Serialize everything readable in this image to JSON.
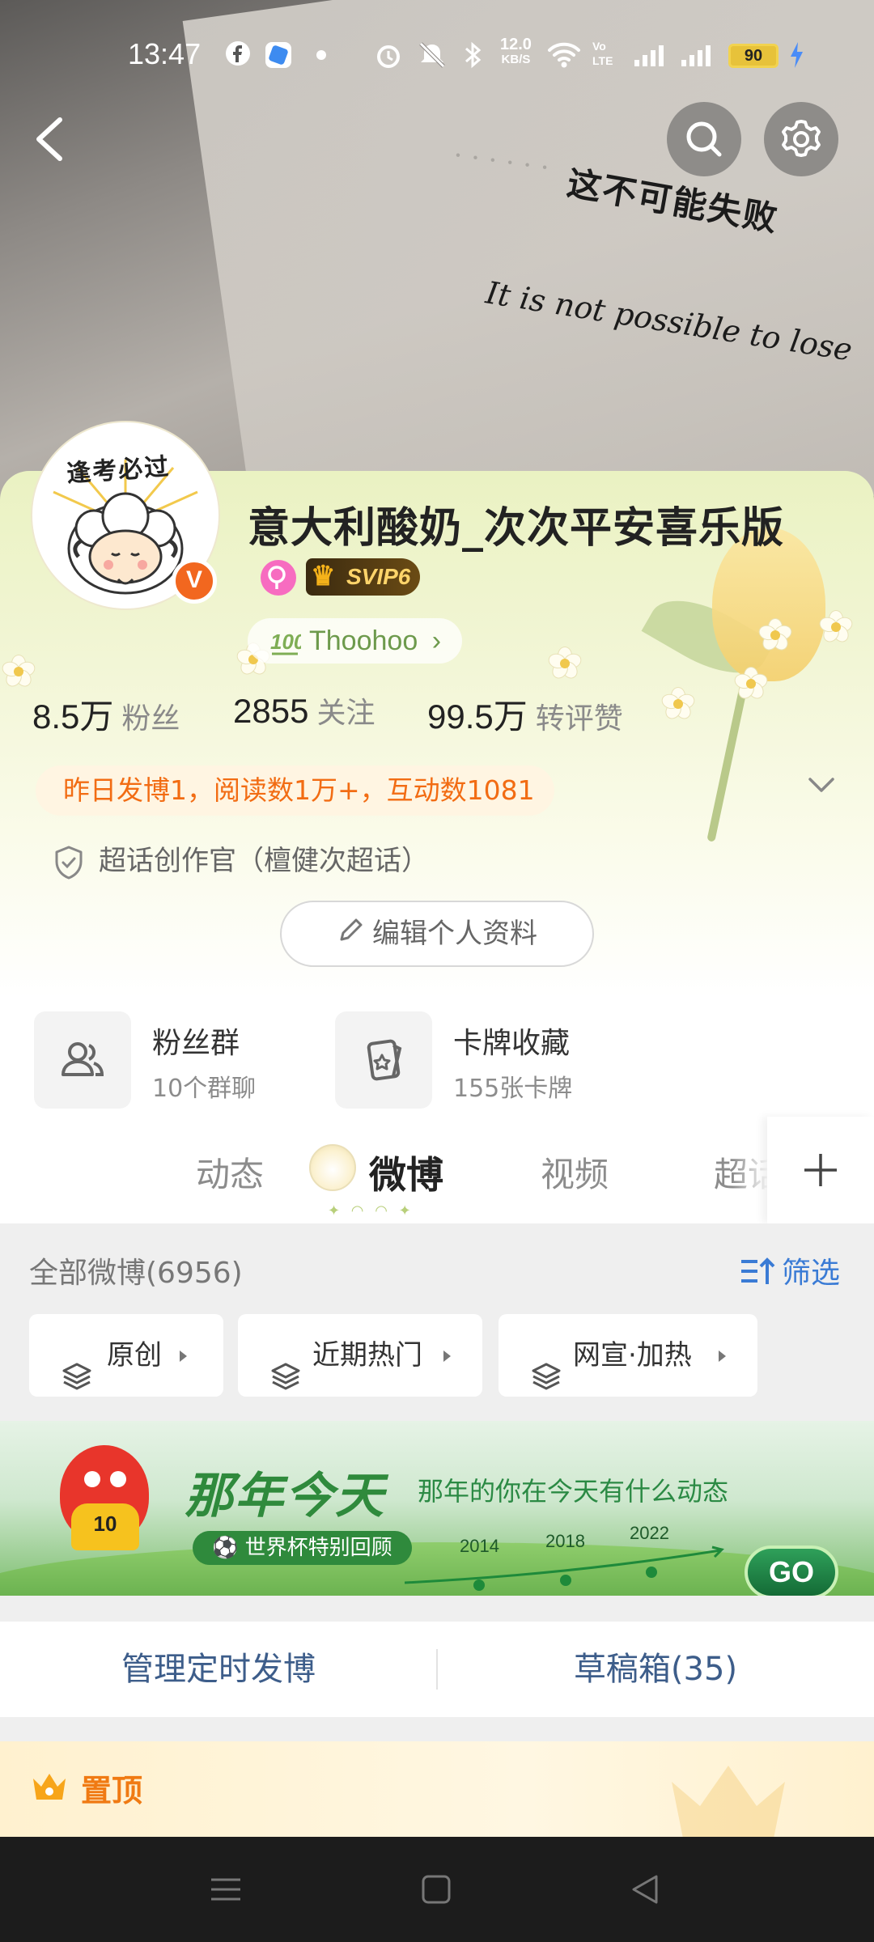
{
  "status_bar": {
    "time": "13:47",
    "net_speed": "12.0",
    "net_unit": "KB/S",
    "volte": "Vo LTE",
    "battery": "90"
  },
  "header": {
    "quote_zh": "这不可能失败",
    "quote_en": "It is not possible to lose"
  },
  "profile": {
    "avatar_text": "逢考必过",
    "verified_mark": "V",
    "name": "意大利酸奶_次次平安喜乐版",
    "svip_label": "SVIP6",
    "tag_label": "Thoohoo",
    "stats": [
      {
        "value": "8.5万",
        "label": "粉丝"
      },
      {
        "value": "2855",
        "label": "关注"
      },
      {
        "value": "99.5万",
        "label": "转评赞"
      }
    ],
    "notice": "昨日发博1，阅读数1万+，互动数1081",
    "supertalk": "超话创作官（檀健次超话）",
    "edit_button": "编辑个人资料"
  },
  "features": [
    {
      "title": "粉丝群",
      "sub": "10个群聊",
      "icon": "group-icon"
    },
    {
      "title": "卡牌收藏",
      "sub": "155张卡牌",
      "icon": "card-icon"
    }
  ],
  "tabs": [
    {
      "label": "动态",
      "active": false
    },
    {
      "label": "微博",
      "active": true
    },
    {
      "label": "视频",
      "active": false
    },
    {
      "label": "超话",
      "active": false
    }
  ],
  "feed": {
    "all_label": "全部微博(6956)",
    "filter_label": "筛选",
    "chips": [
      "原创",
      "近期热门",
      "网宣·加热"
    ]
  },
  "banner": {
    "title": "那年今天",
    "subtitle": "那年的你在今天有什么动态",
    "worldcup": "世界杯特别回顾",
    "years": [
      "2014",
      "2018",
      "2022"
    ],
    "jersey_number": "10",
    "go_label": "GO"
  },
  "manage": {
    "scheduled": "管理定时发博",
    "drafts": "草稿箱(35)"
  },
  "pinned": {
    "label": "置顶"
  },
  "colors": {
    "accent_orange": "#f26c13",
    "link_blue": "#3a7bd5",
    "verified_orange": "#f2671f"
  }
}
